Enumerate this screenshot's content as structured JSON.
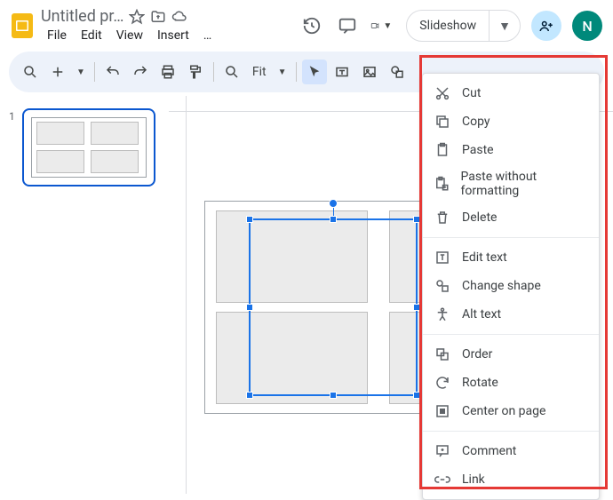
{
  "doc_title": "Untitled pr…",
  "menus": {
    "file": "File",
    "edit": "Edit",
    "view": "View",
    "insert": "Insert",
    "more": "…"
  },
  "slideshow_label": "Slideshow",
  "avatar_letter": "N",
  "zoom_label": "Fit",
  "thumb": {
    "number": "1"
  },
  "context_menu": {
    "cut": "Cut",
    "copy": "Copy",
    "paste": "Paste",
    "paste_plain": "Paste without formatting",
    "delete": "Delete",
    "edit_text": "Edit text",
    "change_shape": "Change shape",
    "alt_text": "Alt text",
    "order": "Order",
    "rotate": "Rotate",
    "center": "Center on page",
    "comment": "Comment",
    "link": "Link"
  }
}
